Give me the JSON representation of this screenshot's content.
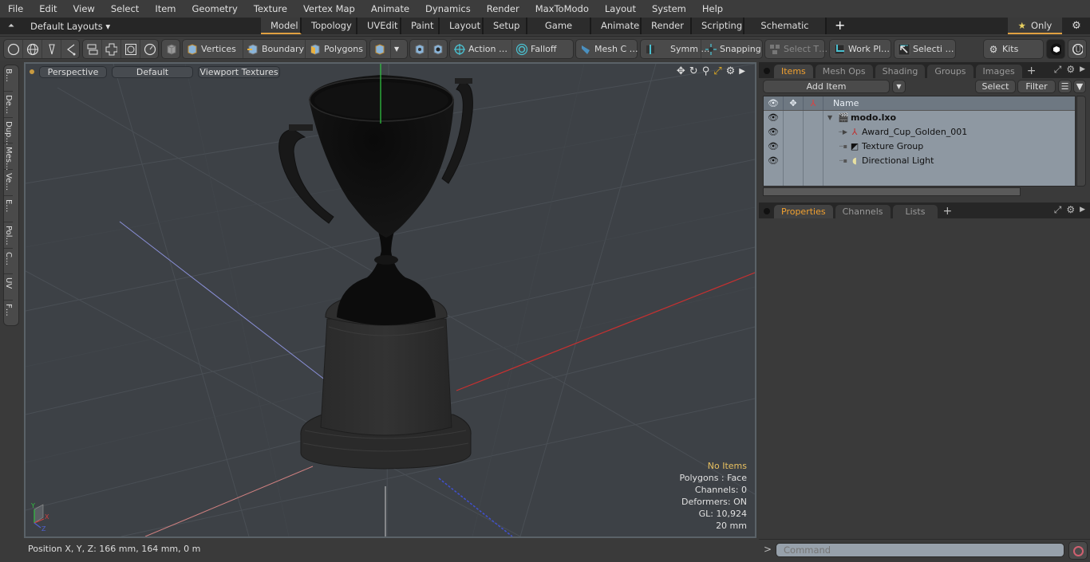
{
  "menu": [
    "File",
    "Edit",
    "View",
    "Select",
    "Item",
    "Geometry",
    "Texture",
    "Vertex Map",
    "Animate",
    "Dynamics",
    "Render",
    "MaxToModo",
    "Layout",
    "System",
    "Help"
  ],
  "layoutbar": {
    "layout_select": "Default Layouts ▾",
    "tabs": [
      "Model",
      "Topology",
      "UVEdit",
      "Paint",
      "Layout",
      "Setup",
      "Game Tools",
      "Animate",
      "Render",
      "Scripting",
      "Schematic Fusion"
    ],
    "active_tab": "Model",
    "add_tab": "+",
    "only_label": "Only",
    "star": "★"
  },
  "toolbar": {
    "vertices": "Vertices",
    "boundary": "Boundary",
    "polygons": "Polygons",
    "action": "Action …",
    "falloff": "Falloff",
    "mesh_c": "Mesh C …",
    "symm": "Symm …",
    "snapping": "Snapping",
    "select_t": "Select T…",
    "work_pl": "Work Pl…",
    "selecti": "Selecti …",
    "kits": "Kits"
  },
  "left_tabs": [
    "B…",
    "De…",
    "Dup…",
    "Mes…",
    "Ve…",
    "E…",
    "Pol…",
    "C…",
    "UV",
    "F…"
  ],
  "viewport": {
    "view_mode": "Perspective",
    "shading": "Default",
    "textures": "Viewport Textures",
    "info": {
      "selection": "No Items",
      "polygons": "Polygons : Face",
      "channels": "Channels: 0",
      "deformers": "Deformers: ON",
      "gl": "GL: 10,924",
      "grid": "20 mm"
    },
    "gizmo": {
      "x": "X",
      "y": "Y",
      "z": "Z"
    }
  },
  "status": {
    "position": "Position X, Y, Z:   166 mm, 164 mm, 0 m"
  },
  "items_panel": {
    "tabs": [
      "Items",
      "Mesh Ops",
      "Shading",
      "Groups",
      "Images"
    ],
    "active_tab": "Items",
    "add_item": "Add Item",
    "select": "Select",
    "filter": "Filter",
    "column_name": "Name",
    "rows": [
      {
        "name": "modo.lxo",
        "type": "scene",
        "bold": true
      },
      {
        "name": "Award_Cup_Golden_001",
        "type": "mesh"
      },
      {
        "name": "Texture Group",
        "type": "texture-group"
      },
      {
        "name": "Directional Light",
        "type": "light"
      }
    ]
  },
  "properties_panel": {
    "tabs": [
      "Properties",
      "Channels",
      "Lists"
    ],
    "active_tab": "Properties"
  },
  "command": {
    "prompt": ">",
    "placeholder": "Command"
  },
  "colors": {
    "accent": "#e0a040",
    "active_tab_text": "#f0a030",
    "info_highlight": "#e8c060",
    "x_axis": "#d04040",
    "y_axis": "#40c040",
    "z_axis": "#5060d0"
  }
}
